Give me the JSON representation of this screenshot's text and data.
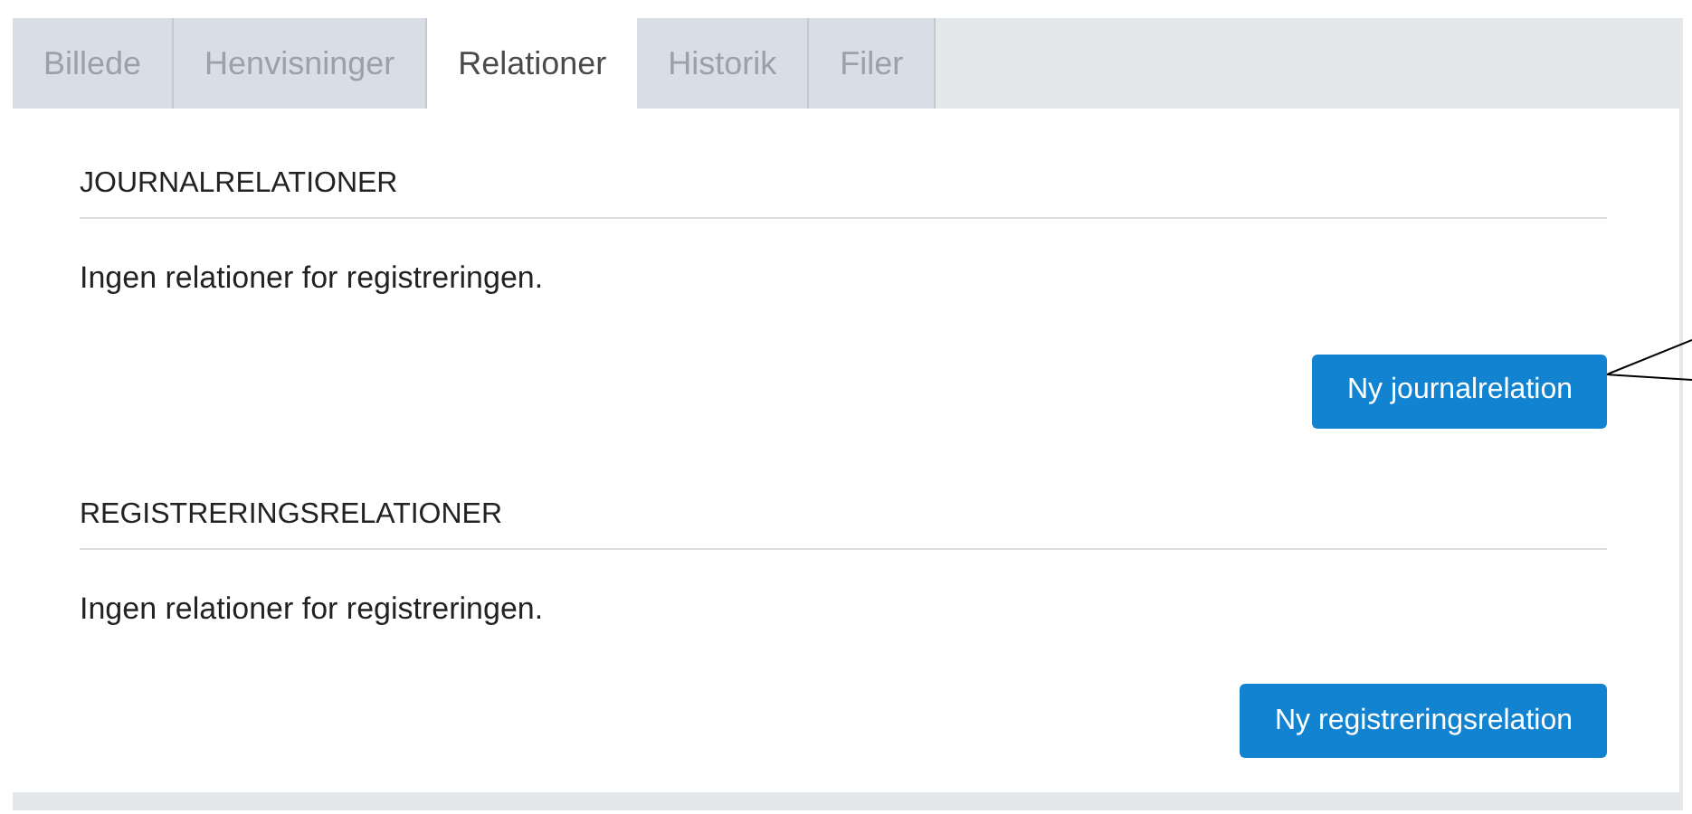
{
  "tabs": [
    {
      "label": "Billede",
      "selected": false
    },
    {
      "label": "Henvisninger",
      "selected": false
    },
    {
      "label": "Relationer",
      "selected": true
    },
    {
      "label": "Historik",
      "selected": false
    },
    {
      "label": "Filer",
      "selected": false
    }
  ],
  "sections": [
    {
      "heading": "JOURNALRELATIONER",
      "message": "Ingen relationer for registreringen.",
      "button": "Ny journalrelation"
    },
    {
      "heading": "REGISTRERINGSRELATIONER",
      "message": "Ingen relationer for registreringen.",
      "button": "Ny registreringsrelation"
    }
  ]
}
